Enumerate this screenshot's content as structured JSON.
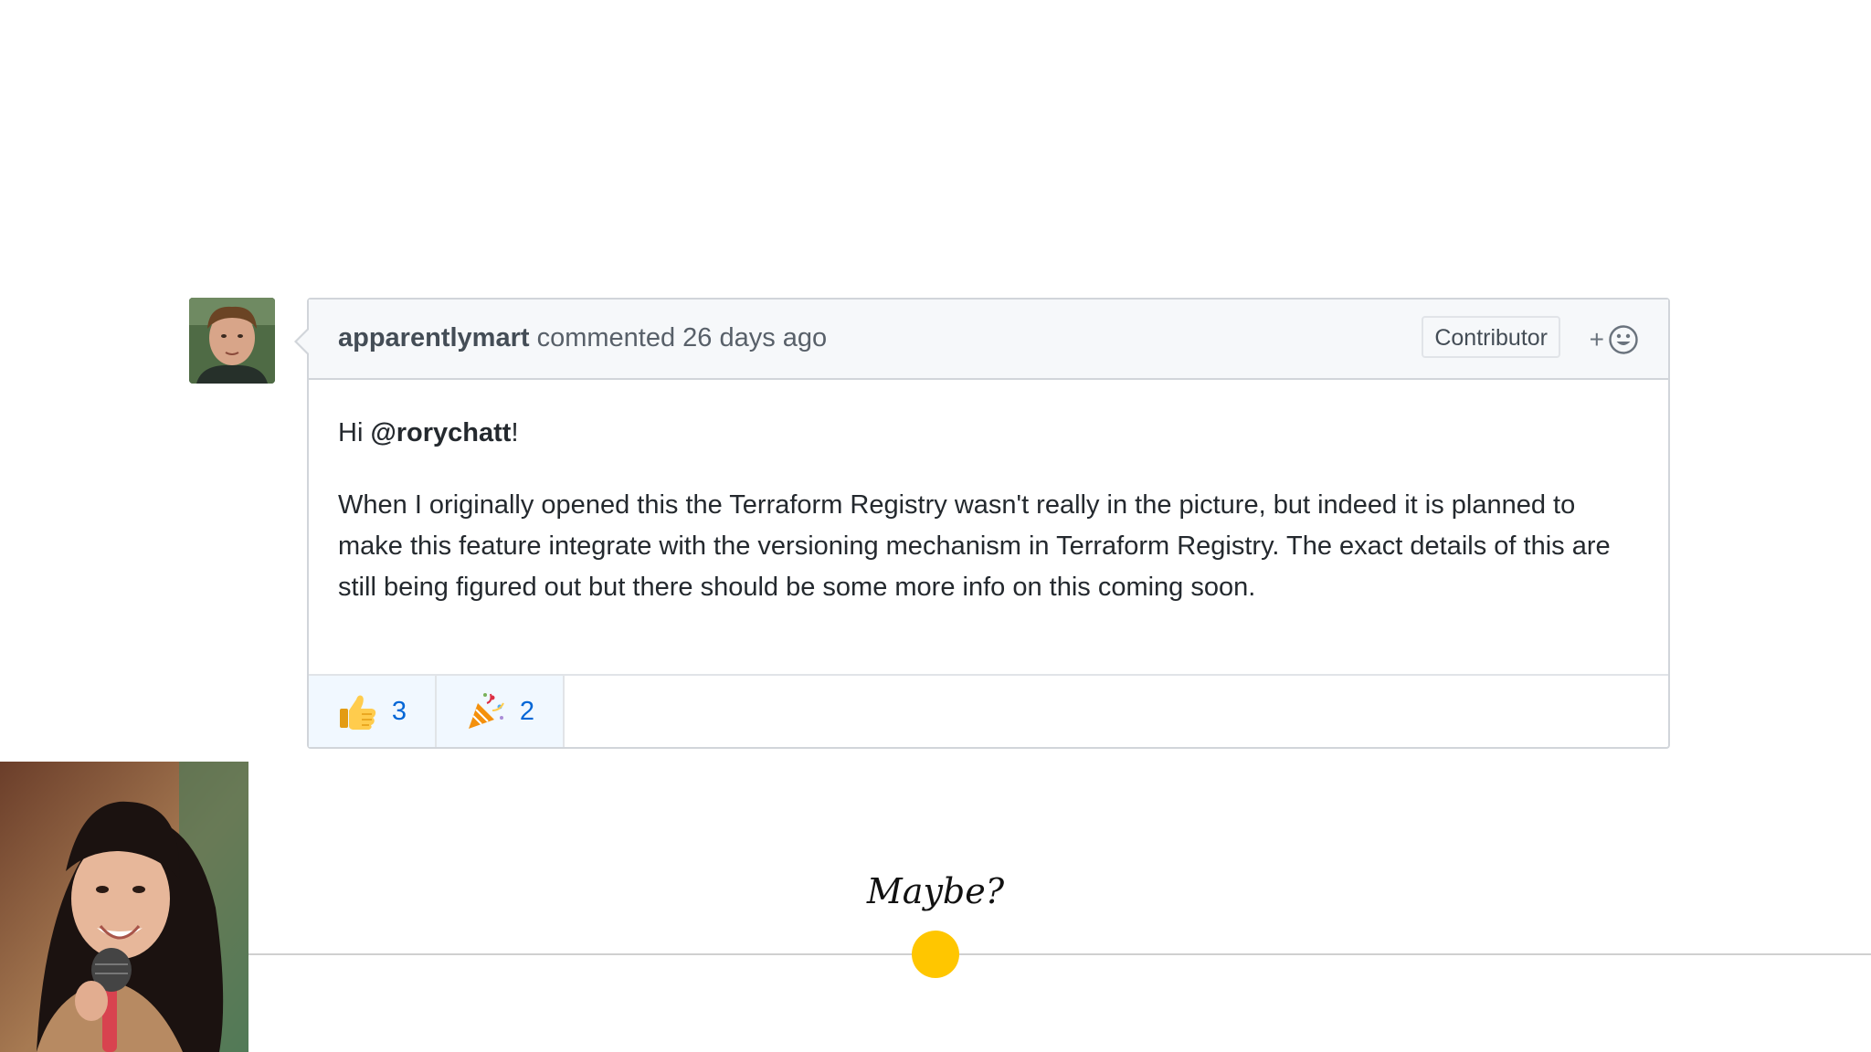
{
  "comment": {
    "author": "apparentlymart",
    "action": "commented",
    "timestamp": "26 days ago",
    "role_badge": "Contributor",
    "add_reaction_label": "+",
    "greeting_prefix": "Hi ",
    "mention": "@rorychatt",
    "greeting_suffix": "!",
    "body": "When I originally opened this the Terraform Registry wasn't really in the picture, but indeed it is planned to make this feature integrate with the versioning mechanism in Terraform Registry. The exact details of this are still being figured out but there should be some more info on this coming soon.",
    "reactions": [
      {
        "icon": "thumbs-up-icon",
        "count": "3"
      },
      {
        "icon": "party-popper-icon",
        "count": "2"
      }
    ]
  },
  "timeline": {
    "label": "Maybe?",
    "dot_color": "#ffc600"
  },
  "colors": {
    "link": "#0366d6",
    "border": "#d1d5da",
    "header_bg": "#f6f8fa"
  }
}
